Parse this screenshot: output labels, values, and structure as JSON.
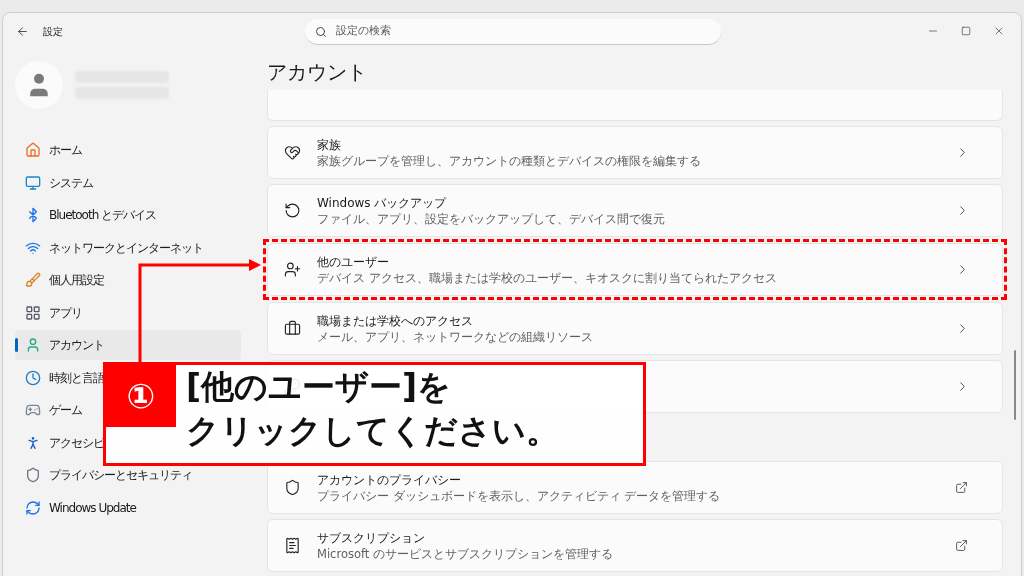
{
  "window": {
    "title": "設定"
  },
  "search": {
    "placeholder": "設定の検索"
  },
  "sidebar": {
    "items": [
      {
        "label": "ホーム",
        "selected": false
      },
      {
        "label": "システム",
        "selected": false
      },
      {
        "label": "Bluetooth とデバイス",
        "selected": false
      },
      {
        "label": "ネットワークとインターネット",
        "selected": false
      },
      {
        "label": "個人用設定",
        "selected": false
      },
      {
        "label": "アプリ",
        "selected": false
      },
      {
        "label": "アカウント",
        "selected": true
      },
      {
        "label": "時刻と言語",
        "selected": false
      },
      {
        "label": "ゲーム",
        "selected": false
      },
      {
        "label": "アクセシビ",
        "selected": false
      },
      {
        "label": "プライバシーとセキュリティ",
        "selected": false
      },
      {
        "label": "Windows Update",
        "selected": false
      }
    ]
  },
  "page": {
    "title": "アカウント"
  },
  "cards": [
    {
      "kind": "stub"
    },
    {
      "kind": "chevron",
      "title": "家族",
      "subtitle": "家族グループを管理し、アカウントの種類とデバイスの権限を編集する"
    },
    {
      "kind": "chevron",
      "title": "Windows バックアップ",
      "subtitle": "ファイル、アプリ、設定をバックアップして、デバイス間で復元"
    },
    {
      "kind": "chevron",
      "title": "他のユーザー",
      "subtitle": "デバイス アクセス、職場または学校のユーザー、キオスクに割り当てられたアクセス",
      "highlighted": true
    },
    {
      "kind": "chevron",
      "title": "職場または学校へのアクセス",
      "subtitle": "メール、アプリ、ネットワークなどの組織リソース"
    },
    {
      "kind": "chevron"
    },
    {
      "kind": "gap"
    },
    {
      "kind": "external",
      "title": "アカウントのプライバシー",
      "subtitle": "プライバシー ダッシュボードを表示し、アクティビティ データを管理する"
    },
    {
      "kind": "external",
      "title": "サブスクリプション",
      "subtitle": "Microsoft のサービスとサブスクリプションを管理する"
    }
  ],
  "annotation": {
    "step": "①",
    "lines": [
      "[他のユーザー]を",
      "クリックしてください。"
    ]
  }
}
